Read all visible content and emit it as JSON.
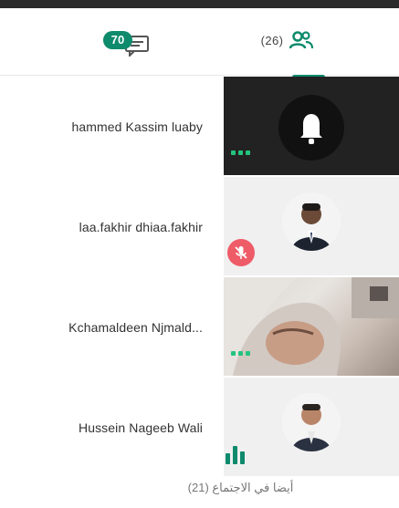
{
  "tabs": {
    "chat_badge": "70",
    "participants_count": "(26)"
  },
  "participants": [
    {
      "name": "hammed Kassim luaby",
      "tile": "dark",
      "status": "active-dots"
    },
    {
      "name": "laa.fakhir dhiaa.fakhir",
      "tile": "light",
      "status": "muted"
    },
    {
      "name": "Kchamaldeen Njmald...",
      "tile": "photo",
      "status": "active-dots"
    },
    {
      "name": "Hussein Nageeb Wali",
      "tile": "light",
      "status": "speaking"
    }
  ],
  "footer": {
    "label": "أيضا في الاجتماع (21)"
  },
  "colors": {
    "accent": "#0e8a6c",
    "muted": "#ee5c68",
    "active_dots": "#23c47e"
  }
}
